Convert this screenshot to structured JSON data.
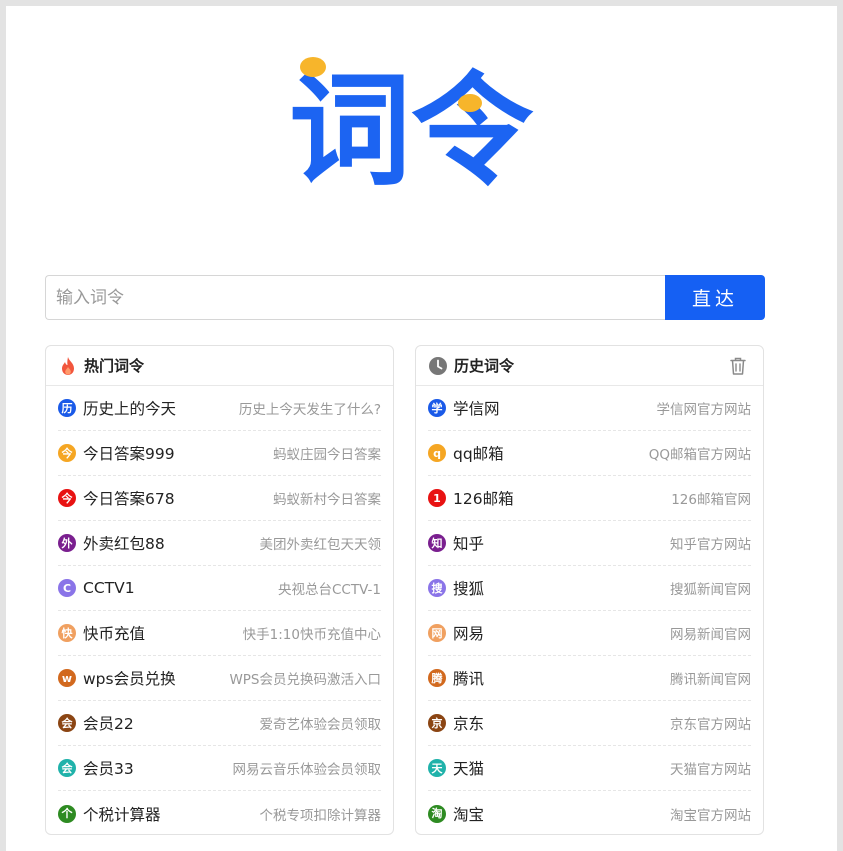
{
  "logo": {
    "text": "词令"
  },
  "search": {
    "placeholder": "输入词令",
    "button_label": "直达"
  },
  "hot": {
    "title": "热门词令",
    "items": [
      {
        "badge": "历",
        "name": "历史上的今天",
        "desc": "历史上今天发生了什么?",
        "color": "#1a5ae8"
      },
      {
        "badge": "今",
        "name": "今日答案999",
        "desc": "蚂蚁庄园今日答案",
        "color": "#f5a623"
      },
      {
        "badge": "今",
        "name": "今日答案678",
        "desc": "蚂蚁新村今日答案",
        "color": "#e81212"
      },
      {
        "badge": "外",
        "name": "外卖红包88",
        "desc": "美团外卖红包天天领",
        "color": "#7a1f8f"
      },
      {
        "badge": "C",
        "name": "CCTV1",
        "desc": "央视总台CCTV-1",
        "color": "#8a74e8"
      },
      {
        "badge": "快",
        "name": "快币充值",
        "desc": "快手1:10快币充值中心",
        "color": "#f0a060"
      },
      {
        "badge": "w",
        "name": "wps会员兑换",
        "desc": "WPS会员兑换码激活入口",
        "color": "#d2691e"
      },
      {
        "badge": "会",
        "name": "会员22",
        "desc": "爱奇艺体验会员领取",
        "color": "#8b4513"
      },
      {
        "badge": "会",
        "name": "会员33",
        "desc": "网易云音乐体验会员领取",
        "color": "#20b2aa"
      },
      {
        "badge": "个",
        "name": "个税计算器",
        "desc": "个税专项扣除计算器",
        "color": "#2e8b22"
      }
    ]
  },
  "history": {
    "title": "历史词令",
    "items": [
      {
        "badge": "学",
        "name": "学信网",
        "desc": "学信网官方网站",
        "color": "#1a5ae8"
      },
      {
        "badge": "q",
        "name": "qq邮箱",
        "desc": "QQ邮箱官方网站",
        "color": "#f5a623"
      },
      {
        "badge": "1",
        "name": "126邮箱",
        "desc": "126邮箱官网",
        "color": "#e81212"
      },
      {
        "badge": "知",
        "name": "知乎",
        "desc": "知乎官方网站",
        "color": "#7a1f8f"
      },
      {
        "badge": "搜",
        "name": "搜狐",
        "desc": "搜狐新闻官网",
        "color": "#8a74e8"
      },
      {
        "badge": "网",
        "name": "网易",
        "desc": "网易新闻官网",
        "color": "#f0a060"
      },
      {
        "badge": "腾",
        "name": "腾讯",
        "desc": "腾讯新闻官网",
        "color": "#d2691e"
      },
      {
        "badge": "京",
        "name": "京东",
        "desc": "京东官方网站",
        "color": "#8b4513"
      },
      {
        "badge": "天",
        "name": "天猫",
        "desc": "天猫官方网站",
        "color": "#20b2aa"
      },
      {
        "badge": "淘",
        "name": "淘宝",
        "desc": "淘宝官方网站",
        "color": "#2e8b22"
      }
    ]
  },
  "colors": {
    "brand_blue": "#1560f3",
    "logo_yellow": "#f5a623"
  },
  "icons": {
    "hot": "flame-icon",
    "history": "clock-icon",
    "clear": "trash-icon"
  }
}
